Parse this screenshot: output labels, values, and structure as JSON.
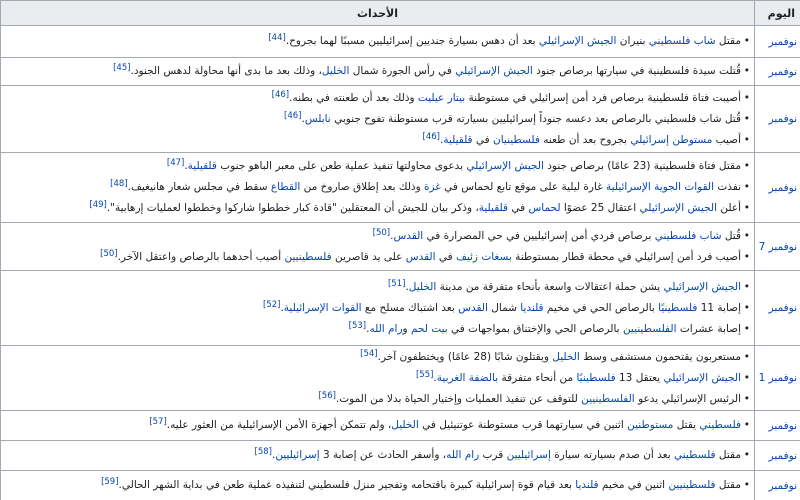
{
  "colors": {
    "link": "#0645ad",
    "text": "#202122",
    "header_bg": "#eaecf0",
    "border": "#a2a9b1"
  },
  "table": {
    "headers": {
      "day": "اليوم",
      "events": "الأحداث"
    },
    "rows": [
      {
        "day": "نوفمبر",
        "events": [
          [
            {
              "text": "مقتل ",
              "kind": "plain"
            },
            {
              "text": "شاب فلسطيني",
              "kind": "link"
            },
            {
              "text": " بنيران ",
              "kind": "plain"
            },
            {
              "text": "الجيش الإسرائيلي",
              "kind": "link"
            },
            {
              "text": " بعد أن دهس بسيارة جنديين إسرائيليين مسببًا لهما بجروح.",
              "kind": "plain"
            },
            {
              "text": "[44]",
              "kind": "ref"
            }
          ]
        ]
      },
      {
        "day": "نوفمبر",
        "events": [
          [
            {
              "text": "قُتلت سيدة فلسطينية في سيارتها برصاص جنود ",
              "kind": "plain"
            },
            {
              "text": "الجيش الإسرائيلي",
              "kind": "link"
            },
            {
              "text": " في رأس الجورة شمال ",
              "kind": "plain"
            },
            {
              "text": "الخليل",
              "kind": "link"
            },
            {
              "text": "، وذلك بعد ما بدى أنها محاولة لدهس الجنود.",
              "kind": "plain"
            },
            {
              "text": "[45]",
              "kind": "ref"
            }
          ]
        ]
      },
      {
        "day": "نوفمبر",
        "events": [
          [
            {
              "text": "أصيبت فتاة فلسطينية برصاص فرد أمن إسرائيلي في مستوطنة ",
              "kind": "plain"
            },
            {
              "text": "بيتار عيليت",
              "kind": "link"
            },
            {
              "text": " وذلك بعد أن طعنته في بطنه.",
              "kind": "plain"
            },
            {
              "text": "[46]",
              "kind": "ref"
            }
          ],
          [
            {
              "text": "قُتل شاب فلسطيني بالرصاص بعد دعسه جنوداً إسرائيليين بسيارته قرب مستوطنة تفوح جنوبي ",
              "kind": "plain"
            },
            {
              "text": "نابلس",
              "kind": "link"
            },
            {
              "text": ".",
              "kind": "plain"
            },
            {
              "text": "[46]",
              "kind": "ref"
            }
          ],
          [
            {
              "text": "أصيب ",
              "kind": "plain"
            },
            {
              "text": "مستوطن إسرائيلي",
              "kind": "link"
            },
            {
              "text": " بجروح بعد أن طعنه ",
              "kind": "plain"
            },
            {
              "text": "فلسطينيان",
              "kind": "link"
            },
            {
              "text": " في ",
              "kind": "plain"
            },
            {
              "text": "قلقيلية",
              "kind": "link"
            },
            {
              "text": ".",
              "kind": "plain"
            },
            {
              "text": "[46]",
              "kind": "ref"
            }
          ]
        ]
      },
      {
        "day": "نوفمبر",
        "events": [
          [
            {
              "text": "مقتل فتاة فلسطينية (23 عامًا) برصاص جنود ",
              "kind": "plain"
            },
            {
              "text": "الجيش الإسرائيلي",
              "kind": "link"
            },
            {
              "text": " بدعوى محاولتها تنفيذ عملية طعن على معبر الباهو جنوب ",
              "kind": "plain"
            },
            {
              "text": "قلقيلية",
              "kind": "link"
            },
            {
              "text": ".",
              "kind": "plain"
            },
            {
              "text": "[47]",
              "kind": "ref"
            }
          ],
          [
            {
              "text": "نفذت ",
              "kind": "plain"
            },
            {
              "text": "القوات الجوية الإسرائيلية",
              "kind": "link"
            },
            {
              "text": " غارة ليلية على موقع تابع لحماس في ",
              "kind": "plain"
            },
            {
              "text": "غزة",
              "kind": "link"
            },
            {
              "text": " وذلك بعد إطلاق صاروخ من ",
              "kind": "plain"
            },
            {
              "text": "القطاع",
              "kind": "link"
            },
            {
              "text": " سقط في مجلس شعار هانيغيف.",
              "kind": "plain"
            },
            {
              "text": "[48]",
              "kind": "ref"
            }
          ],
          [
            {
              "text": "أعلن ",
              "kind": "plain"
            },
            {
              "text": "الجيش الإسرائيلي",
              "kind": "link"
            },
            {
              "text": " اعتقال 25 عضوًا ",
              "kind": "plain"
            },
            {
              "text": "لحماس",
              "kind": "link"
            },
            {
              "text": " في ",
              "kind": "plain"
            },
            {
              "text": "قلقيلية",
              "kind": "link"
            },
            {
              "text": "، وذكر بيان للجيش أن المعتقلين \"قادة كبار خططوا شاركوا وخططوا لعمليات إرهابية\".",
              "kind": "plain"
            },
            {
              "text": "[49]",
              "kind": "ref"
            }
          ]
        ]
      },
      {
        "day": "7 نوفمبر",
        "events": [
          [
            {
              "text": "قُتل ",
              "kind": "plain"
            },
            {
              "text": "شاب فلسطيني",
              "kind": "link"
            },
            {
              "text": " برصاص فردي أمن إسرائيليين في حي المصرارة في ",
              "kind": "plain"
            },
            {
              "text": "القدس",
              "kind": "link"
            },
            {
              "text": ".",
              "kind": "plain"
            },
            {
              "text": "[50]",
              "kind": "ref"
            }
          ],
          [
            {
              "text": "أصيب فرد أمن إسرائيلي في محطة قطار بمستوطنة ",
              "kind": "plain"
            },
            {
              "text": "بسغات زئيف",
              "kind": "link"
            },
            {
              "text": " في ",
              "kind": "plain"
            },
            {
              "text": "القدس",
              "kind": "link"
            },
            {
              "text": " على يد قاصرين ",
              "kind": "plain"
            },
            {
              "text": "فلسطينيين",
              "kind": "link"
            },
            {
              "text": " أصيب أحدهما بالرصاص واعتقل الآخر.",
              "kind": "plain"
            },
            {
              "text": "[50]",
              "kind": "ref"
            }
          ]
        ]
      },
      {
        "day": "نوفمبر",
        "events": [
          [
            {
              "text": "الجيش الإسرائيلي",
              "kind": "link"
            },
            {
              "text": " يشن حملة اعتقالات واسعة بأنحاء متفرقة من مدينة ",
              "kind": "plain"
            },
            {
              "text": "الخليل",
              "kind": "link"
            },
            {
              "text": ".",
              "kind": "plain"
            },
            {
              "text": "[51]",
              "kind": "ref"
            }
          ],
          [
            {
              "text": "إصابة 11 ",
              "kind": "plain"
            },
            {
              "text": "فلسطينيًا",
              "kind": "link"
            },
            {
              "text": " بالرصاص الحي في مخيم ",
              "kind": "plain"
            },
            {
              "text": "قلنديا",
              "kind": "link"
            },
            {
              "text": " شمال ",
              "kind": "plain"
            },
            {
              "text": "القدس",
              "kind": "link"
            },
            {
              "text": " بعد اشتباك مسلح مع ",
              "kind": "plain"
            },
            {
              "text": "القوات الإسرائيلية",
              "kind": "link"
            },
            {
              "text": ".",
              "kind": "plain"
            },
            {
              "text": "[52]",
              "kind": "ref"
            }
          ],
          [
            {
              "text": "إصابة عشرات ",
              "kind": "plain"
            },
            {
              "text": "الفلسطينيين",
              "kind": "link"
            },
            {
              "text": " بالرصاص الحي والإختناق بمواجهات في ",
              "kind": "plain"
            },
            {
              "text": "بيت لحم",
              "kind": "link"
            },
            {
              "text": " و",
              "kind": "plain"
            },
            {
              "text": "رام الله",
              "kind": "link"
            },
            {
              "text": ".",
              "kind": "plain"
            },
            {
              "text": "[53]",
              "kind": "ref"
            }
          ]
        ]
      },
      {
        "day": "1 نوفمبر",
        "events": [
          [
            {
              "text": "مستعربون يقتحمون مستشفى وسط ",
              "kind": "plain"
            },
            {
              "text": "الخليل",
              "kind": "link"
            },
            {
              "text": " ويقتلون شابًا (28 عامًا) ويختطفون آخر.",
              "kind": "plain"
            },
            {
              "text": "[54]",
              "kind": "ref"
            }
          ],
          [
            {
              "text": "الجيش الإسرائيلي",
              "kind": "link"
            },
            {
              "text": " يعتقل 13 ",
              "kind": "plain"
            },
            {
              "text": "فلسطينيًا",
              "kind": "link"
            },
            {
              "text": " من أنحاء متفرقة ",
              "kind": "plain"
            },
            {
              "text": "بالضفة الغربية",
              "kind": "link"
            },
            {
              "text": ".",
              "kind": "plain"
            },
            {
              "text": "[55]",
              "kind": "ref"
            }
          ],
          [
            {
              "text": "الرئيس الإسرائيلي يدعو ",
              "kind": "plain"
            },
            {
              "text": "الفلسطينيين",
              "kind": "link"
            },
            {
              "text": " للتوقف عن تنفيذ العمليات وإختيار الحياة بدلا من الموت.",
              "kind": "plain"
            },
            {
              "text": "[56]",
              "kind": "ref"
            }
          ]
        ]
      },
      {
        "day": "نوفمبر",
        "events": [
          [
            {
              "text": "فلسطيني",
              "kind": "link"
            },
            {
              "text": " يقتل ",
              "kind": "plain"
            },
            {
              "text": "مستوطنين",
              "kind": "link"
            },
            {
              "text": " اثنين في سيارتهما قرب مستوطنة عوتنيئيل في ",
              "kind": "plain"
            },
            {
              "text": "الخليل",
              "kind": "link"
            },
            {
              "text": "، ولم تتمكن أجهزة الأمن الإسرائيلية من العثور عليه.",
              "kind": "plain"
            },
            {
              "text": "[57]",
              "kind": "ref"
            }
          ]
        ]
      },
      {
        "day": "نوفمبر",
        "events": [
          [
            {
              "text": "مقتل ",
              "kind": "plain"
            },
            {
              "text": "فلسطيني",
              "kind": "link"
            },
            {
              "text": " بعد أن صدم بسيارته سيارة ",
              "kind": "plain"
            },
            {
              "text": "إسرائيليين",
              "kind": "link"
            },
            {
              "text": " قرب ",
              "kind": "plain"
            },
            {
              "text": "رام الله",
              "kind": "link"
            },
            {
              "text": "، وأسفر الحادث عن إصابة 3 ",
              "kind": "plain"
            },
            {
              "text": "إسرائيليين",
              "kind": "link"
            },
            {
              "text": ".",
              "kind": "plain"
            },
            {
              "text": "[58]",
              "kind": "ref"
            }
          ]
        ]
      },
      {
        "day": "نوفمبر",
        "events": [
          [
            {
              "text": "مقتل ",
              "kind": "plain"
            },
            {
              "text": "فلسطينيين",
              "kind": "link"
            },
            {
              "text": " اثنين في مخيم ",
              "kind": "plain"
            },
            {
              "text": "قلنديا",
              "kind": "link"
            },
            {
              "text": " بعد قيام قوة إسرائيلية كبيرة باقتحامه وتفجير منزل فلسطيني لتنفيذه عملية طعن في بداية الشهر الحالي.",
              "kind": "plain"
            },
            {
              "text": "[59]",
              "kind": "ref"
            }
          ]
        ]
      }
    ]
  }
}
